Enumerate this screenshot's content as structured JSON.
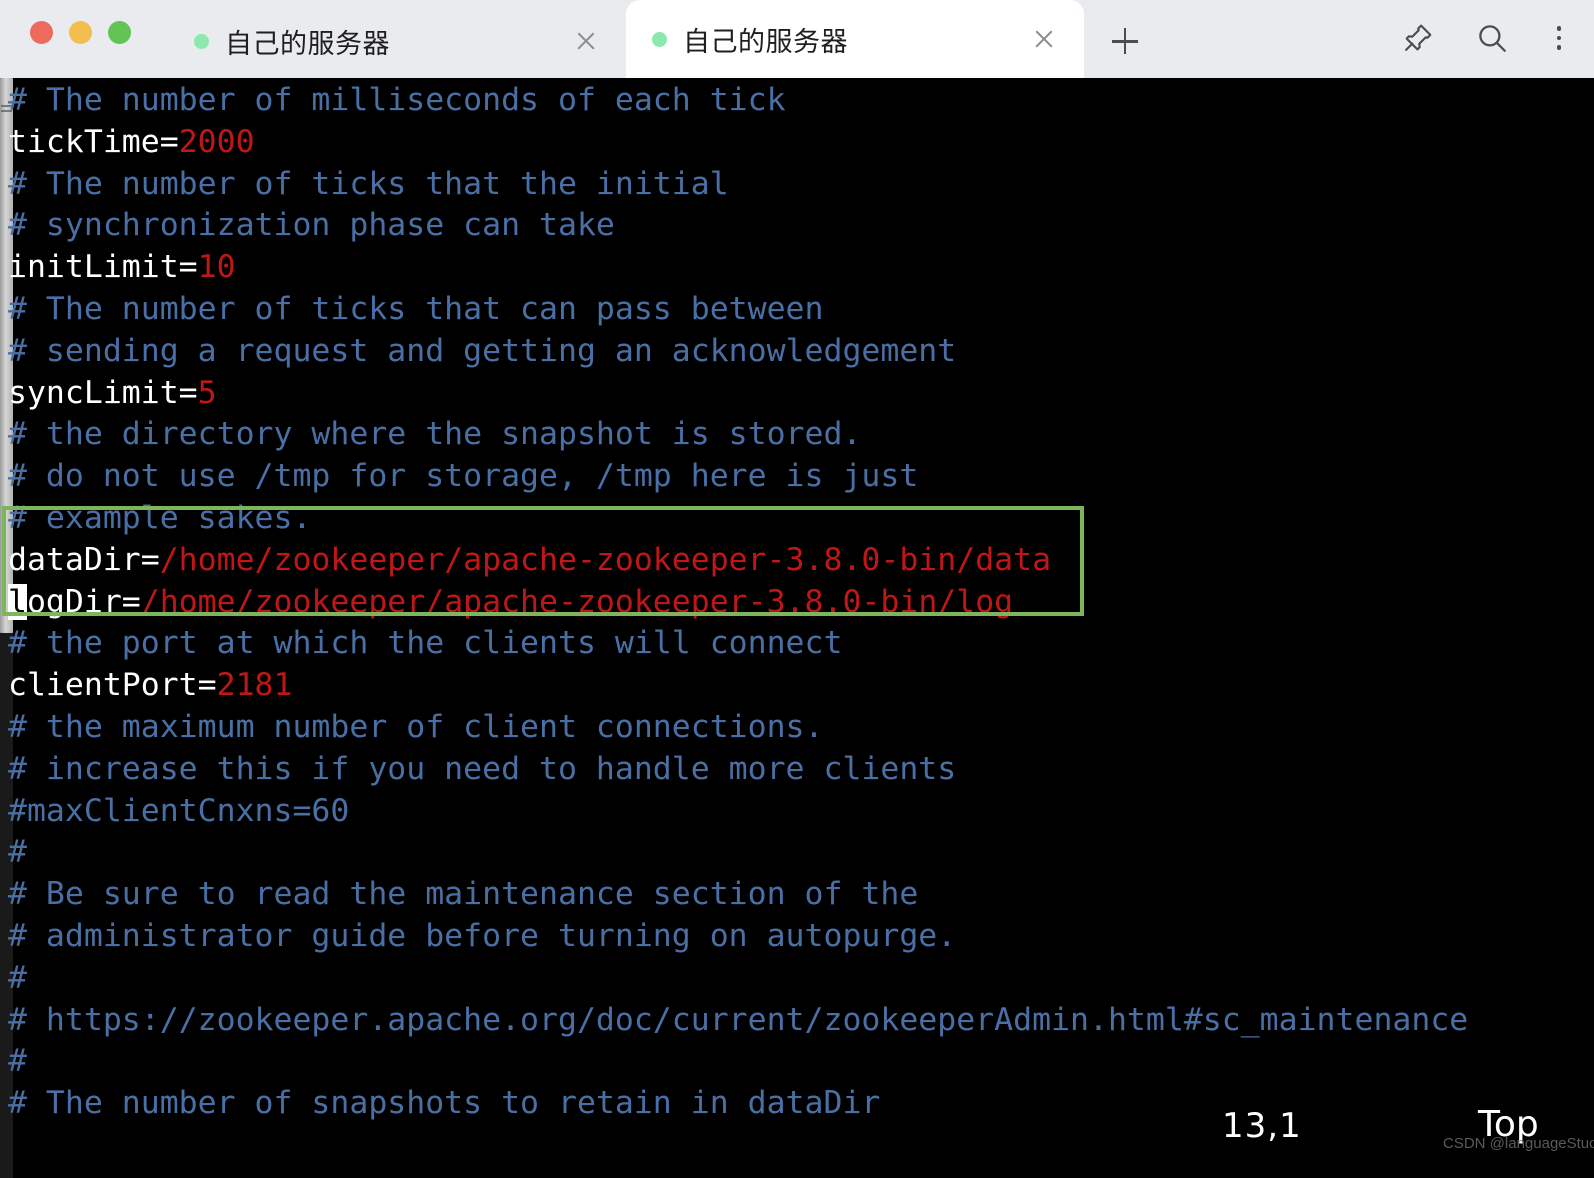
{
  "window": {
    "traffic_lights": [
      {
        "name": "close",
        "color": "#ec6a5e"
      },
      {
        "name": "minimize",
        "color": "#f4bd4f"
      },
      {
        "name": "maximize",
        "color": "#61c454"
      }
    ],
    "tabs": [
      {
        "label": "自己的服务器",
        "status": "connected",
        "active": false
      },
      {
        "label": "自己的服务器",
        "status": "connected",
        "active": true
      }
    ],
    "new_tab_label": "+",
    "actions": [
      {
        "name": "pin-icon",
        "label": "Pin"
      },
      {
        "name": "search-icon",
        "label": "Search"
      },
      {
        "name": "more-icon",
        "label": "More"
      }
    ]
  },
  "editor": {
    "colors": {
      "background": "#000000",
      "comment": "#4a6fa5",
      "key": "#ffffff",
      "value": "#bf1717",
      "highlight_box": "#7cb55c",
      "cursor": "#ffffff"
    },
    "lines": [
      {
        "type": "comment",
        "text": "# The number of milliseconds of each tick"
      },
      {
        "type": "setting",
        "key": "tickTime=",
        "value": "2000"
      },
      {
        "type": "comment",
        "text": "# The number of ticks that the initial"
      },
      {
        "type": "comment",
        "text": "# synchronization phase can take"
      },
      {
        "type": "setting",
        "key": "initLimit=",
        "value": "10"
      },
      {
        "type": "comment",
        "text": "# The number of ticks that can pass between"
      },
      {
        "type": "comment",
        "text": "# sending a request and getting an acknowledgement"
      },
      {
        "type": "setting",
        "key": "syncLimit=",
        "value": "5"
      },
      {
        "type": "comment",
        "text": "# the directory where the snapshot is stored."
      },
      {
        "type": "comment",
        "text": "# do not use /tmp for storage, /tmp here is just"
      },
      {
        "type": "comment",
        "text": "# example sakes."
      },
      {
        "type": "setting",
        "key": "dataDir=",
        "value": "/home/zookeeper/apache-zookeeper-3.8.0-bin/data"
      },
      {
        "type": "setting_cursor",
        "cursor_char": "l",
        "key": "ogDir=",
        "value": "/home/zookeeper/apache-zookeeper-3.8.0-bin/log"
      },
      {
        "type": "comment",
        "text": "# the port at which the clients will connect"
      },
      {
        "type": "setting",
        "key": "clientPort=",
        "value": "2181"
      },
      {
        "type": "comment",
        "text": "# the maximum number of client connections."
      },
      {
        "type": "comment",
        "text": "# increase this if you need to handle more clients"
      },
      {
        "type": "comment",
        "text": "#maxClientCnxns=60"
      },
      {
        "type": "comment",
        "text": "#"
      },
      {
        "type": "comment",
        "text": "# Be sure to read the maintenance section of the"
      },
      {
        "type": "comment",
        "text": "# administrator guide before turning on autopurge."
      },
      {
        "type": "comment",
        "text": "#"
      },
      {
        "type": "comment",
        "text": "# https://zookeeper.apache.org/doc/current/zookeeperAdmin.html#sc_maintenance"
      },
      {
        "type": "comment",
        "text": "#"
      },
      {
        "type": "comment",
        "text": "# The number of snapshots to retain in dataDir"
      }
    ]
  },
  "statusline": {
    "position": "13,1",
    "scroll": "Top"
  },
  "watermark": {
    "text": "CSDN @languageStudent"
  }
}
